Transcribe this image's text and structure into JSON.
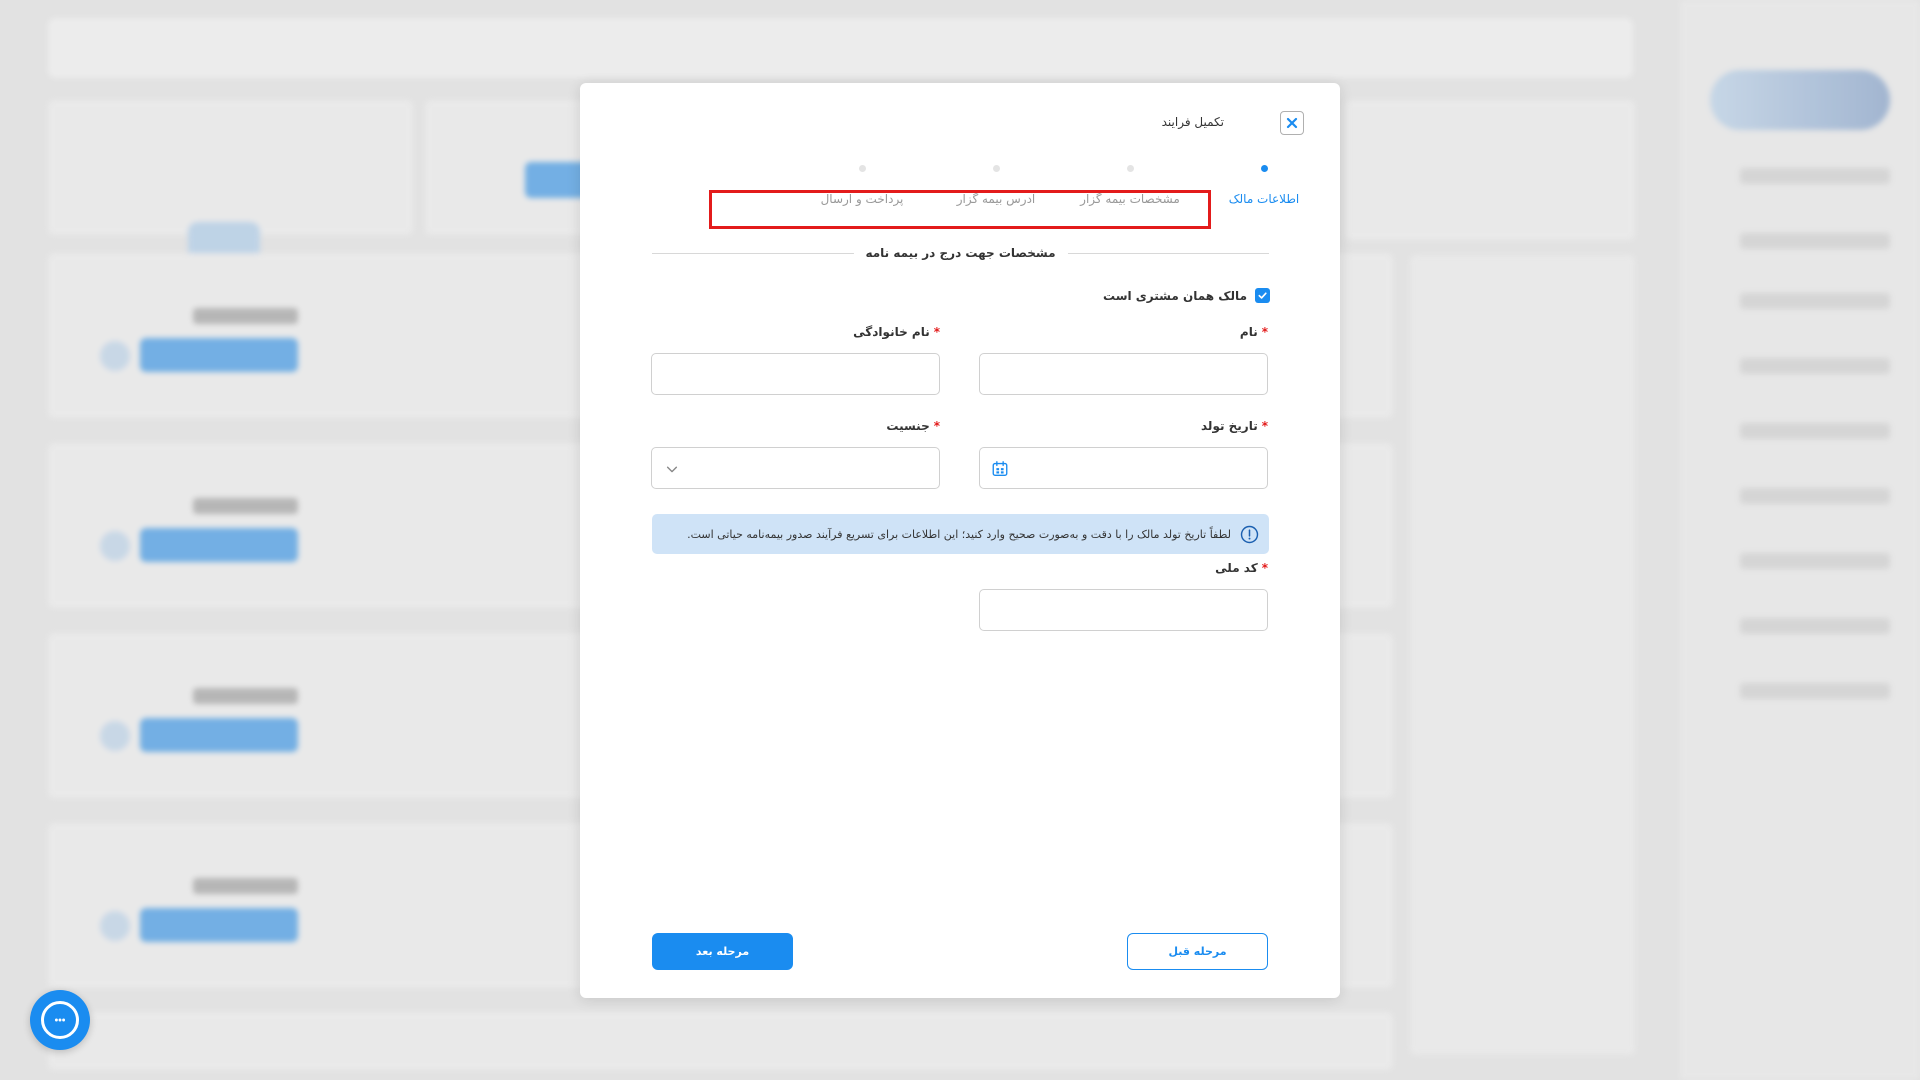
{
  "modal": {
    "title": "تکمیل فرایند",
    "steps": [
      {
        "label": "اطلاعات مالک",
        "active": true
      },
      {
        "label": "مشخصات بیمه گزار",
        "active": false
      },
      {
        "label": "آدرس بیمه گزار",
        "active": false
      },
      {
        "label": "پرداخت و ارسال",
        "active": false
      }
    ],
    "section_title": "مشخصات جهت درج در بیمه نامه",
    "owner_checkbox": {
      "label": "مالک همان مشتری است",
      "checked": true
    },
    "fields": {
      "first_name": {
        "label": "نام",
        "required": true,
        "value": ""
      },
      "last_name": {
        "label": "نام خانوادگی",
        "required": true,
        "value": ""
      },
      "birth_date": {
        "label": "تاریخ تولد",
        "required": true,
        "value": ""
      },
      "gender": {
        "label": "جنسیت",
        "required": true,
        "value": ""
      },
      "national_code": {
        "label": "کد ملی",
        "required": true,
        "value": ""
      }
    },
    "notice": "لطفاً تاریخ تولد مالک را با دقت و به‌صورت صحیح وارد کنید؛ این اطلاعات برای تسریع فرآیند صدور بیمه‌نامه حیاتی است.",
    "buttons": {
      "next": "مرحله بعد",
      "prev": "مرحله قبل"
    }
  },
  "colors": {
    "accent": "#1a8cf0",
    "highlight": "#e31b1b",
    "notice_bg": "#cfe3f7"
  },
  "icons": {
    "close": "close-icon",
    "check": "check-icon",
    "calendar": "calendar-icon",
    "chevron": "chevron-down-icon",
    "info": "info-icon",
    "chat": "chat-icon"
  }
}
